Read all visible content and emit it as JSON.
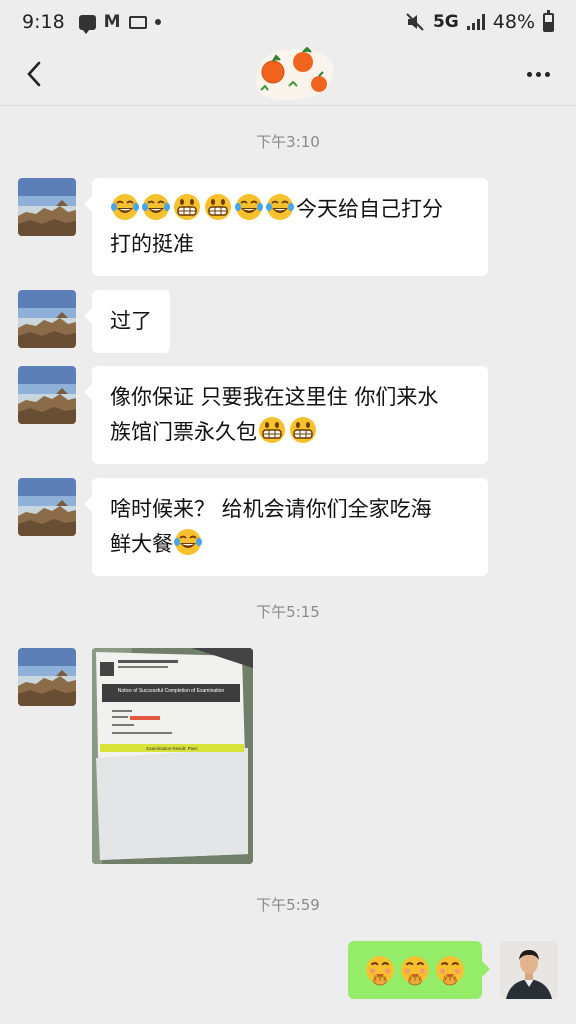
{
  "status_bar": {
    "time": "9:18",
    "network": "5G",
    "battery": "48%"
  },
  "messages": {
    "ts1": "下午3:10",
    "msg1_line1_text": "今天给自己打分",
    "msg1_line2": "打的挺准",
    "msg2": "过了",
    "msg3_line1": "像你保证 只要我在这里住 你们来水",
    "msg3_line2_text": "族馆门票永久包",
    "msg4_line1": "啥时候来？ 给机会请你们全家吃海",
    "msg4_line2_text": "鲜大餐",
    "ts2": "下午5:15",
    "ts3": "下午5:59"
  },
  "photo": {
    "heading": "Notice of Successful Completion of Examination",
    "banner": "Examination Result: Pass"
  },
  "colors": {
    "background": "#ededed",
    "incoming_bubble": "#ffffff",
    "outgoing_bubble": "#95ec69",
    "timestamp": "#8a8a8a"
  },
  "icons": {
    "back": "chevron-left-icon",
    "more": "more-dots-icon",
    "emoji_laugh": "tears-of-joy-emoji",
    "emoji_grin": "grinning-emoji",
    "emoji_shush": "shushing-emoji"
  }
}
